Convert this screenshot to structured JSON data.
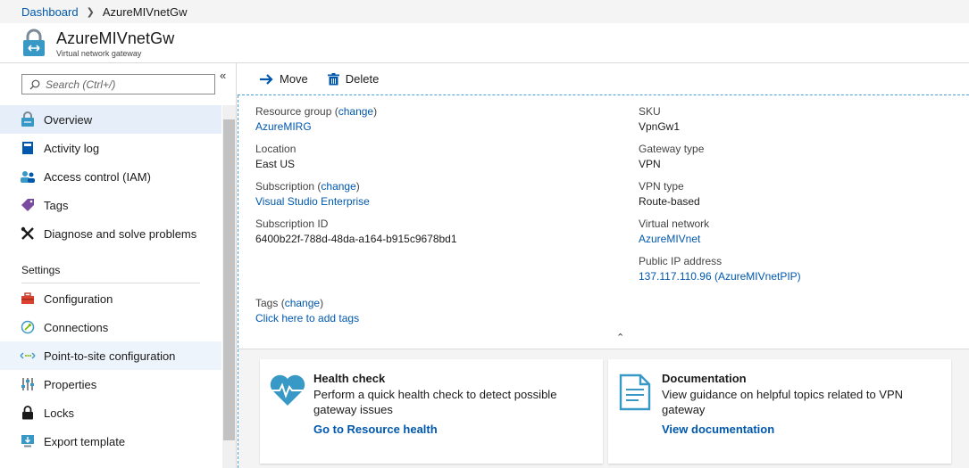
{
  "breadcrumb": {
    "home": "Dashboard",
    "current": "AzureMIVnetGw"
  },
  "resource": {
    "title": "AzureMIVnetGw",
    "type": "Virtual network gateway"
  },
  "search": {
    "placeholder": "Search (Ctrl+/)"
  },
  "sidebar": {
    "items": [
      {
        "label": "Overview",
        "icon": "overview-lock-icon"
      },
      {
        "label": "Activity log",
        "icon": "activity-log-icon"
      },
      {
        "label": "Access control (IAM)",
        "icon": "access-control-icon"
      },
      {
        "label": "Tags",
        "icon": "tag-icon"
      },
      {
        "label": "Diagnose and solve problems",
        "icon": "wrench-icon"
      }
    ],
    "settings_label": "Settings",
    "settings_items": [
      {
        "label": "Configuration",
        "icon": "toolbox-icon"
      },
      {
        "label": "Connections",
        "icon": "connections-icon"
      },
      {
        "label": "Point-to-site configuration",
        "icon": "point-to-site-icon"
      },
      {
        "label": "Properties",
        "icon": "properties-icon"
      },
      {
        "label": "Locks",
        "icon": "lock-icon"
      },
      {
        "label": "Export template",
        "icon": "export-template-icon"
      }
    ]
  },
  "toolbar": {
    "move": "Move",
    "delete": "Delete"
  },
  "essentials": {
    "change": "change",
    "resource_group": {
      "label": "Resource group",
      "value": "AzureMIRG"
    },
    "location": {
      "label": "Location",
      "value": "East US"
    },
    "subscription": {
      "label": "Subscription",
      "value": "Visual Studio Enterprise"
    },
    "subscription_id": {
      "label": "Subscription ID",
      "value": "6400b22f-788d-48da-a164-b915c9678bd1"
    },
    "sku": {
      "label": "SKU",
      "value": "VpnGw1"
    },
    "gateway_type": {
      "label": "Gateway type",
      "value": "VPN"
    },
    "vpn_type": {
      "label": "VPN type",
      "value": "Route-based"
    },
    "virtual_network": {
      "label": "Virtual network",
      "value": "AzureMIVnet"
    },
    "public_ip": {
      "label": "Public IP address",
      "value": "137.117.110.96 (AzureMIVnetPIP)"
    },
    "tags": {
      "label": "Tags",
      "value": "Click here to add tags"
    }
  },
  "cards": {
    "health": {
      "title": "Health check",
      "desc": "Perform a quick health check to detect possible gateway issues",
      "link": "Go to Resource health"
    },
    "docs": {
      "title": "Documentation",
      "desc": "View guidance on helpful topics related to VPN gateway",
      "link": "View documentation"
    }
  },
  "colors": {
    "accent": "#0058ad",
    "active_nav": "#e5eef9",
    "icon_blue": "#3999c6"
  }
}
